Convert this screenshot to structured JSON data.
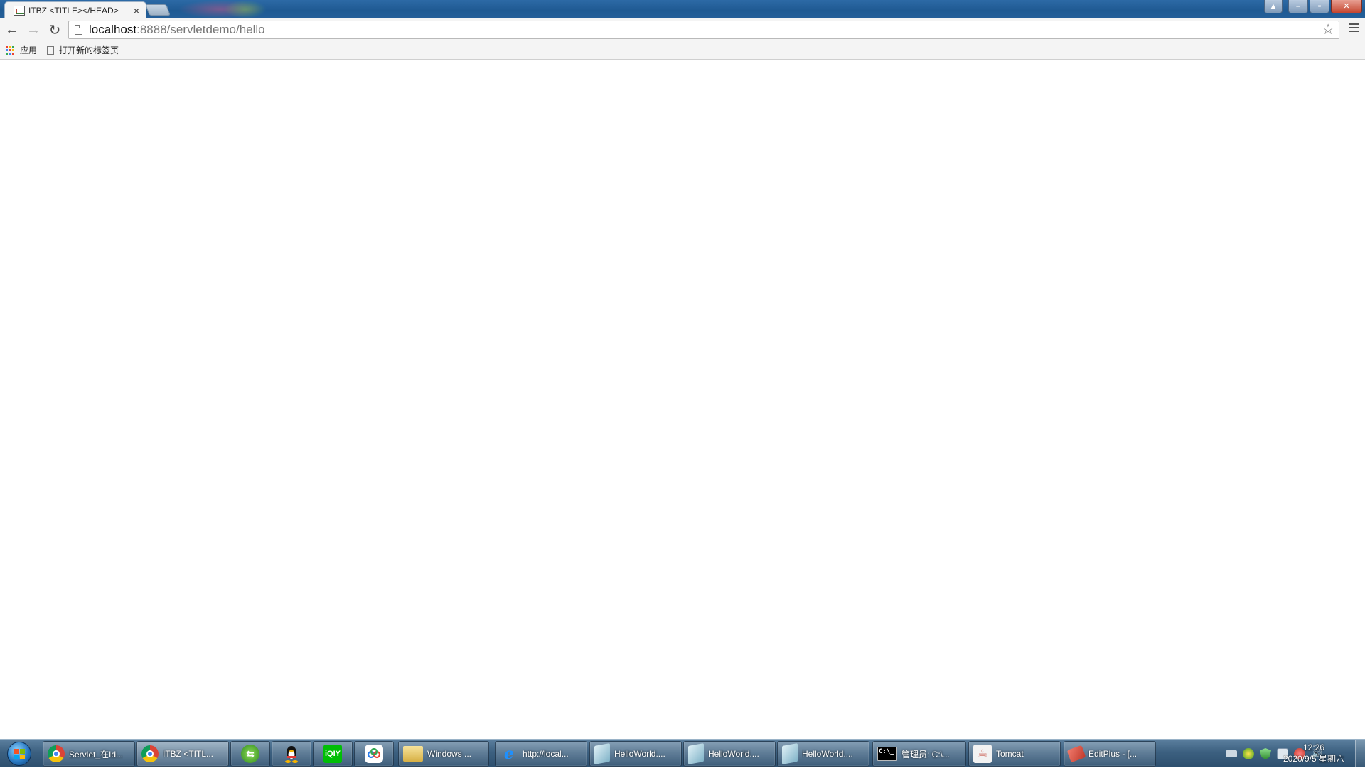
{
  "browser": {
    "tab_title": "ITBZ <TITLE></HEAD>",
    "url_host": "localhost",
    "url_rest": ":8888/servletdemo/hello"
  },
  "bookmarks": [
    {
      "label": "应用",
      "icon": "apps-grid-icon"
    },
    {
      "label": "打开新的标签页",
      "icon": "page-icon"
    }
  ],
  "taskbar": {
    "items": [
      {
        "label": "Servlet_在Id...",
        "icon": "chrome-icon"
      },
      {
        "label": "ITBZ <TITL...",
        "icon": "chrome-icon"
      },
      {
        "label": "",
        "icon": "green-arrow-icon"
      },
      {
        "label": "",
        "icon": "qq-penguin-icon"
      },
      {
        "label": "",
        "icon": "iqiyi-icon"
      },
      {
        "label": "",
        "icon": "baidu-netdisk-icon"
      },
      {
        "label": "Windows ...",
        "icon": "folder-icon"
      },
      {
        "label": "http://local...",
        "icon": "ie-icon"
      },
      {
        "label": "HelloWorld....",
        "icon": "document-icon"
      },
      {
        "label": "HelloWorld....",
        "icon": "document-icon"
      },
      {
        "label": "HelloWorld....",
        "icon": "document-icon"
      },
      {
        "label": "管理员: C:\\...",
        "icon": "cmd-icon"
      },
      {
        "label": "Tomcat",
        "icon": "java-icon"
      },
      {
        "label": "EditPlus - [...",
        "icon": "editplus-icon"
      }
    ],
    "clock_time": "12:26",
    "clock_date": "2020/9/5 星期六"
  },
  "colors": {
    "titlebar": "#1f5a93",
    "toolbar": "#f4f4f4",
    "taskbar": "#3c6080"
  }
}
